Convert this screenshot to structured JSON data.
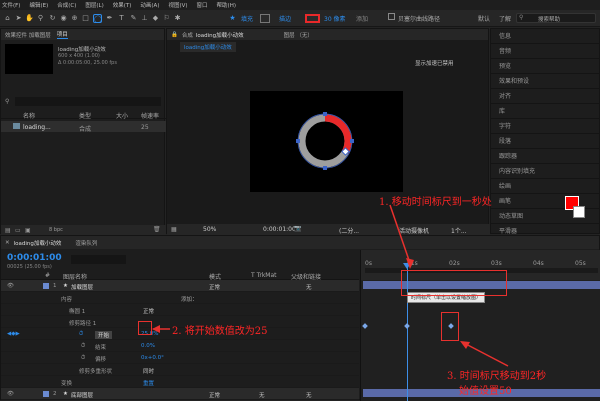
{
  "menu": [
    "文件(F)",
    "编辑(E)",
    "合成(C)",
    "图层(L)",
    "效果(T)",
    "动画(A)",
    "视图(V)",
    "窗口",
    "帮助(H)"
  ],
  "toolbar": {
    "fill": "填充",
    "stroke_label": "描边",
    "stroke_value": "30 像素",
    "add_label": "添加",
    "bezier": "贝塞尔曲线路径",
    "default_label": "默认",
    "learn": "了解",
    "search_help": "搜索帮助"
  },
  "project": {
    "tab_effects": "效果控件 加载图层",
    "tab_project": "项目",
    "comp_name": "loading加载小动效",
    "comp_size": "600 x 400 (1.00)",
    "comp_duration": "Δ 0:00:05:00, 25.00 fps",
    "col_name": "名称",
    "col_type": "类型",
    "col_size": "大小",
    "col_fps": "帧速率",
    "item_name": "loading...",
    "item_type": "合成",
    "item_fps": "25",
    "bpc": "8 bpc"
  },
  "comp": {
    "title_prefix": "合成",
    "title_name": "loading加载小动效",
    "layer_label": "图层 （无）",
    "tab": "loading加载小动效",
    "status": "显示加速已禁用",
    "zoom": "50%",
    "time": "0:00:01:00",
    "res": "(二分...",
    "camera": "活动摄像机",
    "views": "1个..."
  },
  "right_panel": {
    "items": [
      "信息",
      "音频",
      "预览",
      "效果和预设",
      "对齐",
      "库",
      "字符",
      "段落",
      "跟踪器",
      "内容识别填充",
      "绘画",
      "画笔",
      "动态草图",
      "平滑器",
      "摇摆器",
      "蒙版插值"
    ]
  },
  "timeline": {
    "tab": "loading加载小动效",
    "tab2": "渲染队列",
    "time": "0:00:01:00",
    "frames": "00025 (25.00 fps)",
    "col_num": "#",
    "col_name": "图层名称",
    "col_mode": "模式",
    "col_trkmat": "T TrkMat",
    "col_parent": "父级和链接",
    "rows": [
      {
        "num": "1",
        "name": "加载图层",
        "mode": "正常",
        "parent": "无"
      },
      {
        "name": "内容",
        "extra": "添加："
      },
      {
        "name": "椭圆 1",
        "mode": "正常"
      },
      {
        "name": "修剪路径 1"
      },
      {
        "name": "开始",
        "value": "25.0%"
      },
      {
        "name": "结束",
        "value": "0.0%"
      },
      {
        "name": "偏移",
        "value": "0x+0.0°"
      },
      {
        "name": "修剪多重形状",
        "value": "同时"
      },
      {
        "name": "变换",
        "value": "重置"
      },
      {
        "num": "2",
        "name": "底部图层",
        "mode": "正常",
        "trk": "无",
        "parent": "无"
      }
    ],
    "ruler": [
      "0s",
      "01s",
      "02s",
      "03s",
      "04s",
      "05s"
    ],
    "tooltip": "时间标尺（单击以设置缩放图）"
  },
  "annotations": {
    "a1": "1. 移动时间标尺到一秒处",
    "a2": "2. 将开始数值改为25",
    "a3_line1": "3. 时间标尺移动到2秒",
    "a3_line2": "始值设置50"
  },
  "colors": {
    "accent": "#2d8ceb",
    "ring_red": "#e8292a",
    "ring_gray": "#9e9e9e",
    "annotation": "#ff2626"
  }
}
